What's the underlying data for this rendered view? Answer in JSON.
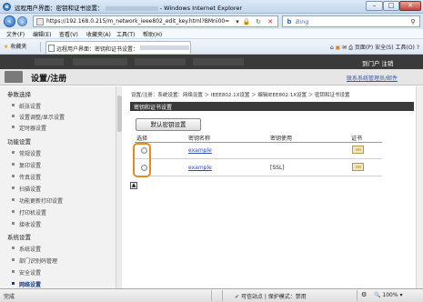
{
  "window": {
    "title": "远程用户界面：密钥和证书设置： - Windows Internet Explorer",
    "title_prefix": "远程用户界面：密钥和证书设置：",
    "title_suffix": "- Windows Internet Explorer",
    "controls": {
      "minimize": "–",
      "maximize": "□",
      "close": "✕"
    }
  },
  "addressbar": {
    "url": "https://192.168.0.215/m_network_ieee802_edit_key.html?BMni00=",
    "search_placeholder": "Bing",
    "search_icon": "magnifier-icon"
  },
  "menubar": [
    "文件(F)",
    "编辑(E)",
    "查看(V)",
    "收藏夹(A)",
    "工具(T)",
    "帮助(H)"
  ],
  "favbar": {
    "favorites_label": "收藏夹",
    "tab_title": "远程用户界面：密钥和证书设置：",
    "tools": [
      "页面(P)",
      "安全(S)",
      "工具(O)",
      "?"
    ]
  },
  "app": {
    "title": "设置/注册",
    "top_links": [
      "到门户",
      "注销"
    ],
    "admin_link": "联系系统管理员/邮件"
  },
  "sidebar": {
    "sections": [
      {
        "label": "参数选择",
        "items": [
          "纸张设置",
          "设置调整/显示设置",
          "定时器设置"
        ]
      },
      {
        "label": "功能设置",
        "items": [
          "常规设置",
          "复印设置",
          "传真设置",
          "扫描设置",
          "功能更新打印设置",
          "打印机设置",
          "接收设置"
        ]
      },
      {
        "label": "系统设置",
        "items": [
          "系统设置",
          "部门识别码管理",
          "安全设置",
          "网络设置"
        ]
      }
    ],
    "selected": "网络设置"
  },
  "breadcrumb": "设置/注册：系统设置：网络设置 ＞ IEEE802.1X设置 ＞ 编辑IEEE802.1X设置 ＞ 密钥和证书设置",
  "section_title": "密钥和证书设置",
  "default_key_button": "默认密钥设置",
  "table": {
    "headers": [
      "选择",
      "密钥名称",
      "密钥使用",
      "证书"
    ],
    "rows": [
      {
        "key_name": "example",
        "key_usage": "",
        "selected": false
      },
      {
        "key_name": "example",
        "key_usage": "[SSL]",
        "selected": false
      }
    ]
  },
  "statusbar": {
    "status": "完成",
    "zone": "可信站点 | 保护模式：禁用",
    "zoom": "100%"
  }
}
